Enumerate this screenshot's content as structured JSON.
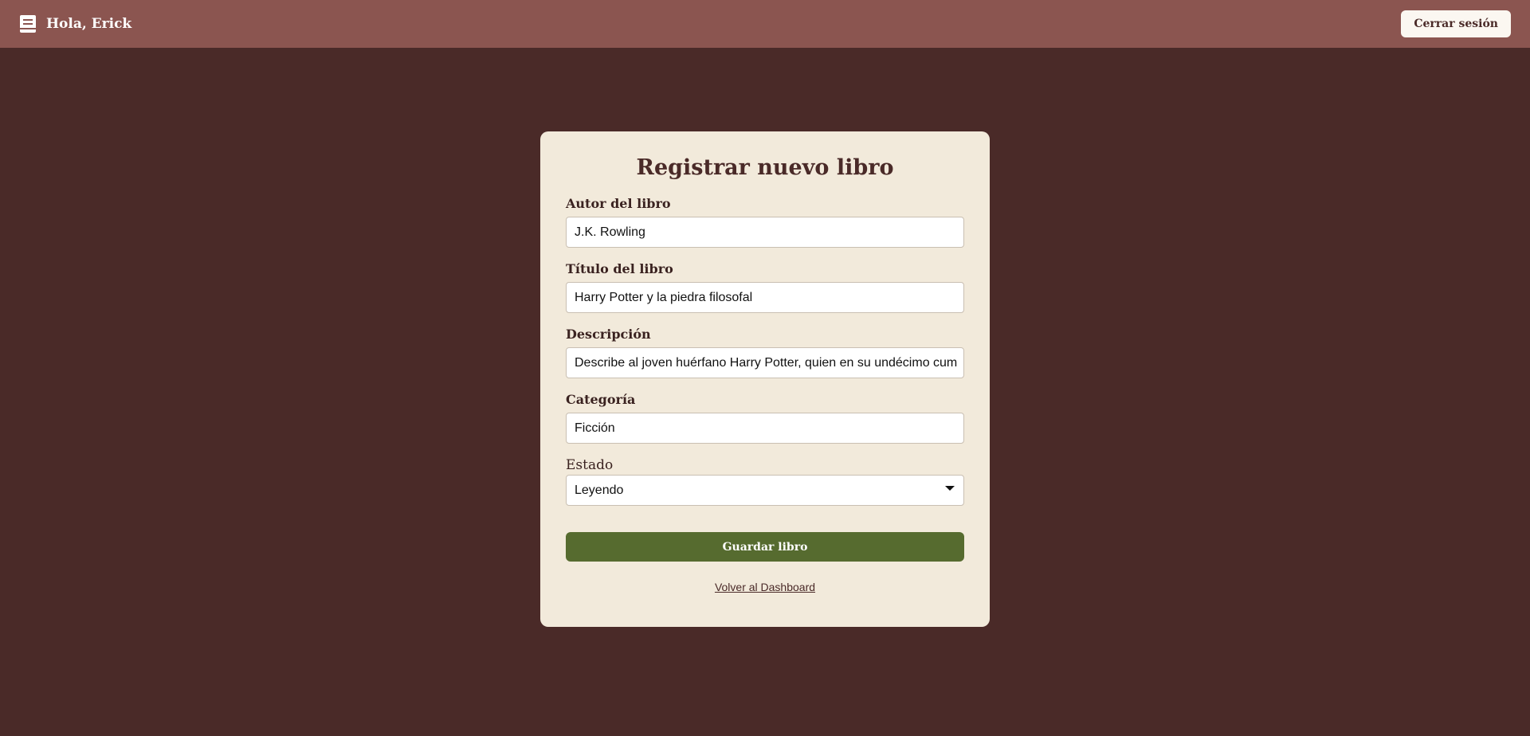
{
  "navbar": {
    "greeting": "Hola, Erick",
    "icon": "book-icon",
    "logout_label": "Cerrar sesión"
  },
  "form": {
    "title": "Registrar nuevo libro",
    "author": {
      "label": "Autor del libro",
      "value": "J.K. Rowling"
    },
    "book_title": {
      "label": "Título del libro",
      "value": "Harry Potter y la piedra filosofal"
    },
    "description": {
      "label": "Descripción",
      "value": "Describe al joven huérfano Harry Potter, quien en su undécimo cum"
    },
    "category": {
      "label": "Categoría",
      "value": "Ficción"
    },
    "status": {
      "label": "Estado",
      "value": "Leyendo"
    },
    "save_label": "Guardar libro",
    "back_label": "Volver al Dashboard"
  },
  "colors": {
    "background": "#4a2a28",
    "navbar": "#8b5550",
    "card": "#f2eadb",
    "primary_button": "#566b2f"
  }
}
